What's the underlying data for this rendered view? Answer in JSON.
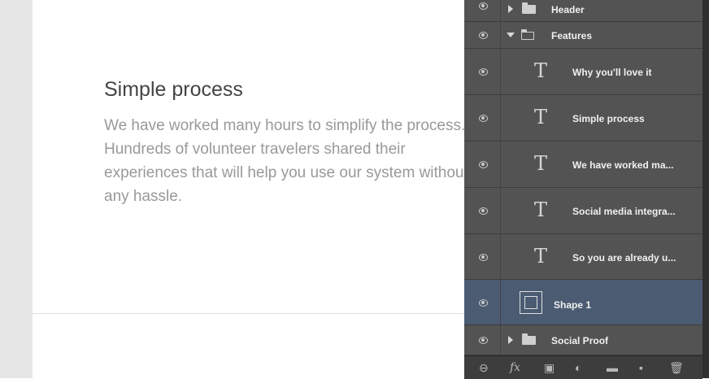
{
  "document": {
    "title": "Simple process",
    "paragraph": "We have worked many hours to simplify the process.\nHundreds of volunteer travelers shared their\nexperiences that will help you use our system without\nany hassle."
  },
  "layers_panel": {
    "layers": [
      {
        "name": "Header",
        "kind": "group",
        "expanded": false
      },
      {
        "name": "Features",
        "kind": "group",
        "expanded": true
      },
      {
        "name": "Why you'll love it",
        "kind": "text",
        "icon_text": "T"
      },
      {
        "name": "Simple process",
        "kind": "text",
        "icon_text": "T"
      },
      {
        "name": "We have worked ma...",
        "kind": "text",
        "icon_text": "T"
      },
      {
        "name": "Social media integra...",
        "kind": "text",
        "icon_text": "T"
      },
      {
        "name": "So you are already u...",
        "kind": "text",
        "icon_text": "T"
      },
      {
        "name": "Shape 1",
        "kind": "shape",
        "selected": true
      },
      {
        "name": "Social Proof",
        "kind": "group",
        "expanded": false
      }
    ],
    "toolbar": {
      "link": "⊖",
      "fx": "fx",
      "mask": "▣",
      "adjustment": "◐",
      "new_group": "▬",
      "new_layer": "▪",
      "delete": "🗑"
    },
    "colors": {
      "panel_bg": "#535353",
      "selected_bg": "#4a5b72"
    }
  }
}
